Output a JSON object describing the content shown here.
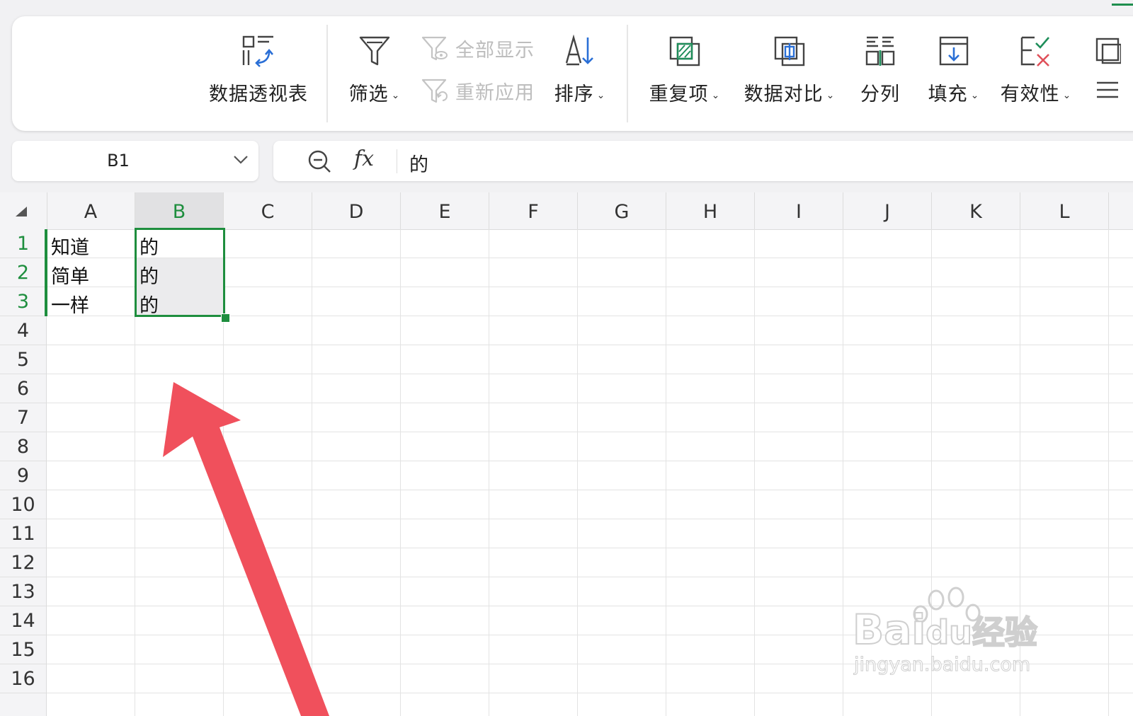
{
  "ribbon": {
    "pivot": "数据透视表",
    "filter": "筛选",
    "show_all": "全部显示",
    "reapply": "重新应用",
    "sort": "排序",
    "duplicates": "重复项",
    "compare": "数据对比",
    "split": "分列",
    "fill": "填充",
    "validity": "有效性",
    "dropdown_caret": "⌄"
  },
  "formula_bar": {
    "cell_ref": "B1",
    "fx_label": "fx",
    "value": "的"
  },
  "sheet": {
    "columns": [
      "A",
      "B",
      "C",
      "D",
      "E",
      "F",
      "G",
      "H",
      "I",
      "J",
      "K",
      "L"
    ],
    "selected_column": "B",
    "rows": [
      "1",
      "2",
      "3",
      "4",
      "5",
      "6",
      "7",
      "8",
      "9",
      "10",
      "11",
      "12",
      "13",
      "14",
      "15",
      "16"
    ],
    "selected_rows": [
      "1",
      "2",
      "3"
    ],
    "cells": {
      "A1": "知道",
      "A2": "简单",
      "A3": "一样",
      "B1": "的",
      "B2": "的",
      "B3": "的"
    },
    "selection_range": "B1:B3"
  },
  "colors": {
    "accent_green": "#1e8e3e",
    "arrow_red": "#f0505c"
  },
  "watermark": {
    "brand": "Bai",
    "paw": "du",
    "cn": "经验",
    "url": "jingyan.baidu.com"
  }
}
